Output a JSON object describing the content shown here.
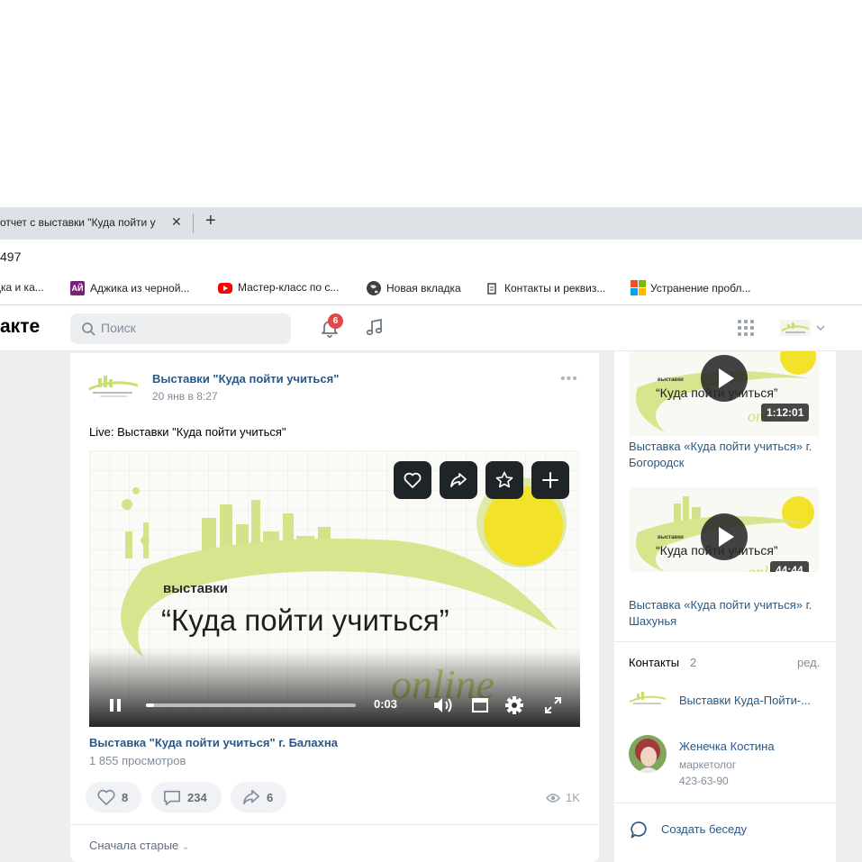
{
  "browser": {
    "tab_title": "отчет с выставки \"Куда пойти у",
    "address_text": "497",
    "bookmarks": [
      {
        "label": "дка и ка...",
        "icon": "generic-icon"
      },
      {
        "label": "Аджика из черной...",
        "icon": "recipe-site-icon",
        "badge": "АЙ"
      },
      {
        "label": "Мастер-класс по с...",
        "icon": "youtube-icon"
      },
      {
        "label": "Новая вкладка",
        "icon": "globe-icon"
      },
      {
        "label": "Контакты и реквиз...",
        "icon": "document-icon"
      },
      {
        "label": "Устранение пробл...",
        "icon": "microsoft-icon"
      }
    ]
  },
  "vk_header": {
    "logo": "акте",
    "search_placeholder": "Поиск",
    "notifications_count": "6"
  },
  "post": {
    "author": "Выставки \"Куда пойти учиться\"",
    "date": "20 янв в 8:27",
    "text": "Live: Выставки \"Куда пойти учиться\"",
    "video": {
      "art_small": "выставки",
      "art_title": "“Куда пойти учиться”",
      "art_online": "online",
      "current_time": "0:03",
      "progress": 0.04
    },
    "video_title": "Выставка \"Куда пойти учиться\" г. Балахна",
    "views_text": "1 855 просмотров",
    "likes": "8",
    "comments": "234",
    "shares": "6",
    "views_short": "1K",
    "sort_label": "Сначала старые"
  },
  "sidebar": {
    "videos": [
      {
        "title": "Выставка «Куда пойти учиться» г. Богородск",
        "duration": "1:12:01",
        "art_small": "выставки",
        "art_title": "“Куда пойти учиться”",
        "art_online": "online"
      },
      {
        "title": "Выставка «Куда пойти учиться» г. Шахунья",
        "duration": "44:44",
        "art_small": "выставки",
        "art_title": "“Куда пойти учиться”",
        "art_online": "online"
      }
    ],
    "contacts_label": "Контакты",
    "contacts_count": "2",
    "contacts_edit": "ред.",
    "contacts": [
      {
        "name": "Выставки Куда-Пойти-..."
      },
      {
        "name": "Женечка Костина",
        "role": "маркетолог",
        "phone": "423-63-90"
      }
    ],
    "create_chat": "Создать беседу"
  },
  "colors": {
    "vk_link": "#2a5885",
    "lime": "#c8e06e",
    "sun": "#f3e22a",
    "badge_red": "#e64646",
    "page_bg": "#edeef0"
  }
}
